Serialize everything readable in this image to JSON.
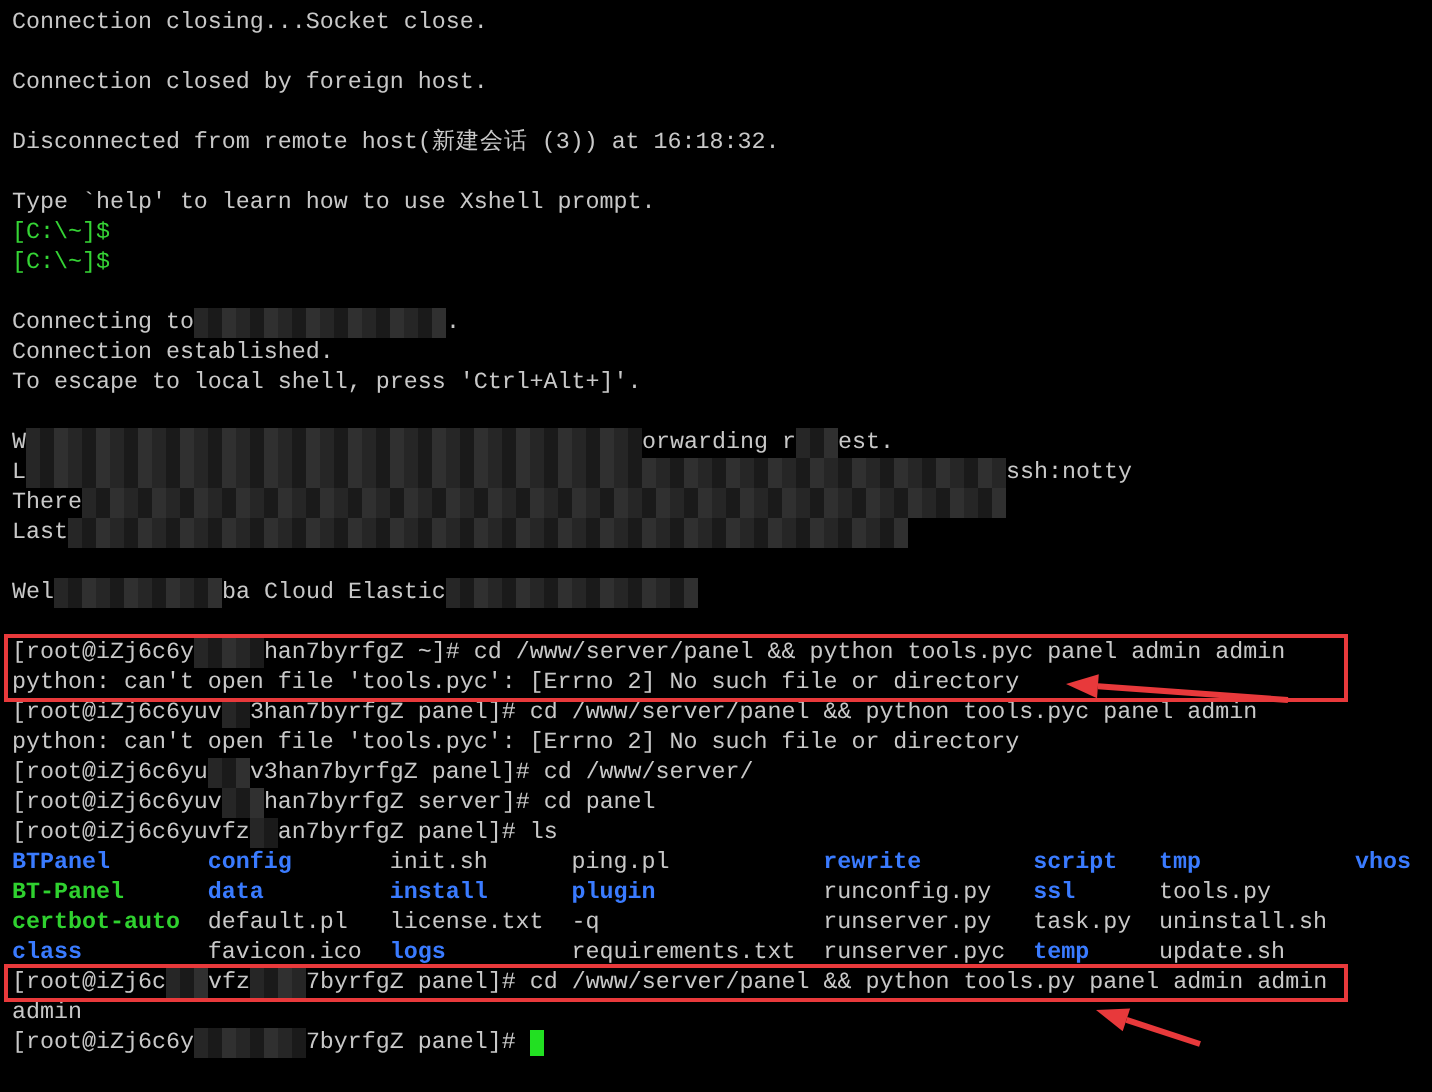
{
  "terminal": {
    "lines": [
      {
        "kind": "text",
        "segments": [
          {
            "kind": "text",
            "text": "Connection closing...Socket close."
          }
        ]
      },
      {
        "kind": "blank"
      },
      {
        "kind": "text",
        "segments": [
          {
            "kind": "text",
            "text": "Connection closed by foreign host."
          }
        ]
      },
      {
        "kind": "blank"
      },
      {
        "kind": "text",
        "segments": [
          {
            "kind": "text",
            "text": "Disconnected from remote host(新建会话 (3)) at 16:18:32."
          }
        ]
      },
      {
        "kind": "blank"
      },
      {
        "kind": "text",
        "segments": [
          {
            "kind": "text",
            "text": "Type `help' to learn how to use Xshell prompt."
          }
        ]
      },
      {
        "kind": "text",
        "segments": [
          {
            "kind": "prompt",
            "text": "[C:\\~]$"
          }
        ]
      },
      {
        "kind": "text",
        "segments": [
          {
            "kind": "prompt",
            "text": "[C:\\~]$"
          }
        ]
      },
      {
        "kind": "blank"
      },
      {
        "kind": "text",
        "segments": [
          {
            "kind": "text",
            "text": "Connecting to"
          },
          {
            "kind": "redacted"
          },
          {
            "kind": "text",
            "text": "."
          }
        ]
      },
      {
        "kind": "text",
        "segments": [
          {
            "kind": "text",
            "text": "Connection established."
          }
        ]
      },
      {
        "kind": "text",
        "segments": [
          {
            "kind": "text",
            "text": "To escape to local shell, press 'Ctrl+Alt+]'."
          }
        ]
      },
      {
        "kind": "blank"
      },
      {
        "kind": "text",
        "segments": [
          {
            "kind": "text",
            "text": "W"
          },
          {
            "kind": "redacted"
          },
          {
            "kind": "text",
            "text": "orwarding r"
          },
          {
            "kind": "redacted"
          },
          {
            "kind": "text",
            "text": "est."
          }
        ]
      },
      {
        "kind": "text",
        "segments": [
          {
            "kind": "text",
            "text": "L"
          },
          {
            "kind": "redacted"
          },
          {
            "kind": "text",
            "text": "ssh:notty"
          }
        ]
      },
      {
        "kind": "text",
        "segments": [
          {
            "kind": "text",
            "text": "There"
          },
          {
            "kind": "redacted"
          }
        ]
      },
      {
        "kind": "text",
        "segments": [
          {
            "kind": "text",
            "text": "Last"
          },
          {
            "kind": "redacted"
          }
        ]
      },
      {
        "kind": "blank"
      },
      {
        "kind": "text",
        "segments": [
          {
            "kind": "text",
            "text": "Wel"
          },
          {
            "kind": "redacted"
          },
          {
            "kind": "text",
            "text": "ba Cloud Elastic"
          },
          {
            "kind": "redacted"
          }
        ]
      },
      {
        "kind": "blank"
      },
      {
        "kind": "highlight",
        "lines": [
          {
            "kind": "text",
            "segments": [
              {
                "kind": "text",
                "text": "[root@iZj6c6y"
              },
              {
                "kind": "redacted"
              },
              {
                "kind": "text",
                "text": "han7byrfgZ ~]# cd /www/server/panel && python tools.pyc panel admin admin"
              }
            ]
          },
          {
            "kind": "text",
            "segments": [
              {
                "kind": "text",
                "text": "python: can't open file 'tools.pyc': [Errno 2] No such file or directory"
              }
            ]
          }
        ]
      },
      {
        "kind": "text",
        "segments": [
          {
            "kind": "text",
            "text": "[root@iZj6c6yuv"
          },
          {
            "kind": "redacted"
          },
          {
            "kind": "text",
            "text": "3han7byrfgZ panel]# cd /www/server/panel && python tools.pyc panel admin"
          }
        ]
      },
      {
        "kind": "text",
        "segments": [
          {
            "kind": "text",
            "text": "python: can't open file 'tools.pyc': [Errno 2] No such file or directory"
          }
        ]
      },
      {
        "kind": "text",
        "segments": [
          {
            "kind": "text",
            "text": "[root@iZj6c6yu"
          },
          {
            "kind": "redacted"
          },
          {
            "kind": "text",
            "text": "v3han7byrfgZ panel]# cd /www/server/"
          }
        ]
      },
      {
        "kind": "text",
        "segments": [
          {
            "kind": "text",
            "text": "[root@iZj6c6yuv"
          },
          {
            "kind": "redacted"
          },
          {
            "kind": "text",
            "text": "han7byrfgZ server]# cd panel"
          }
        ]
      },
      {
        "kind": "text",
        "segments": [
          {
            "kind": "text",
            "text": "[root@iZj6c6yuvfz"
          },
          {
            "kind": "redacted"
          },
          {
            "kind": "text",
            "text": "an7byrfgZ panel]# ls"
          }
        ]
      },
      {
        "kind": "listing",
        "rows": [
          [
            {
              "name": "BTPanel",
              "kind": "dir"
            },
            {
              "name": "config",
              "kind": "dir"
            },
            {
              "name": "init.sh",
              "kind": "file"
            },
            {
              "name": "ping.pl",
              "kind": "file"
            },
            {
              "name": "rewrite",
              "kind": "dir"
            },
            {
              "name": "script",
              "kind": "dir"
            },
            {
              "name": "tmp",
              "kind": "dir"
            },
            {
              "name": "vhos",
              "kind": "dir"
            }
          ],
          [
            {
              "name": "BT-Panel",
              "kind": "exec"
            },
            {
              "name": "data",
              "kind": "dir"
            },
            {
              "name": "install",
              "kind": "dir"
            },
            {
              "name": "plugin",
              "kind": "dir"
            },
            {
              "name": "runconfig.py",
              "kind": "file"
            },
            {
              "name": "ssl",
              "kind": "dir"
            },
            {
              "name": "tools.py",
              "kind": "file"
            }
          ],
          [
            {
              "name": "certbot-auto",
              "kind": "exec"
            },
            {
              "name": "default.pl",
              "kind": "file"
            },
            {
              "name": "license.txt",
              "kind": "file"
            },
            {
              "name": "-q",
              "kind": "file"
            },
            {
              "name": "runserver.py",
              "kind": "file"
            },
            {
              "name": "task.py",
              "kind": "file"
            },
            {
              "name": "uninstall.sh",
              "kind": "file"
            }
          ],
          [
            {
              "name": "class",
              "kind": "dir"
            },
            {
              "name": "favicon.ico",
              "kind": "file"
            },
            {
              "name": "logs",
              "kind": "dir"
            },
            {
              "name": "requirements.txt",
              "kind": "file"
            },
            {
              "name": "runserver.pyc",
              "kind": "file"
            },
            {
              "name": "temp",
              "kind": "dir"
            },
            {
              "name": "update.sh",
              "kind": "file"
            }
          ]
        ]
      },
      {
        "kind": "highlight",
        "lines": [
          {
            "kind": "text",
            "segments": [
              {
                "kind": "text",
                "text": "[root@iZj6c"
              },
              {
                "kind": "redacted"
              },
              {
                "kind": "text",
                "text": "vfz"
              },
              {
                "kind": "redacted"
              },
              {
                "kind": "text",
                "text": "7byrfgZ panel]# cd /www/server/panel && python tools.py panel admin admin"
              }
            ]
          }
        ]
      },
      {
        "kind": "text",
        "segments": [
          {
            "kind": "text",
            "text": "admin"
          }
        ]
      },
      {
        "kind": "text",
        "segments": [
          {
            "kind": "text",
            "text": "[root@iZj6c6y"
          },
          {
            "kind": "redacted"
          },
          {
            "kind": "text",
            "text": "7byrfgZ panel]#"
          },
          {
            "kind": "cursor"
          }
        ]
      }
    ]
  }
}
